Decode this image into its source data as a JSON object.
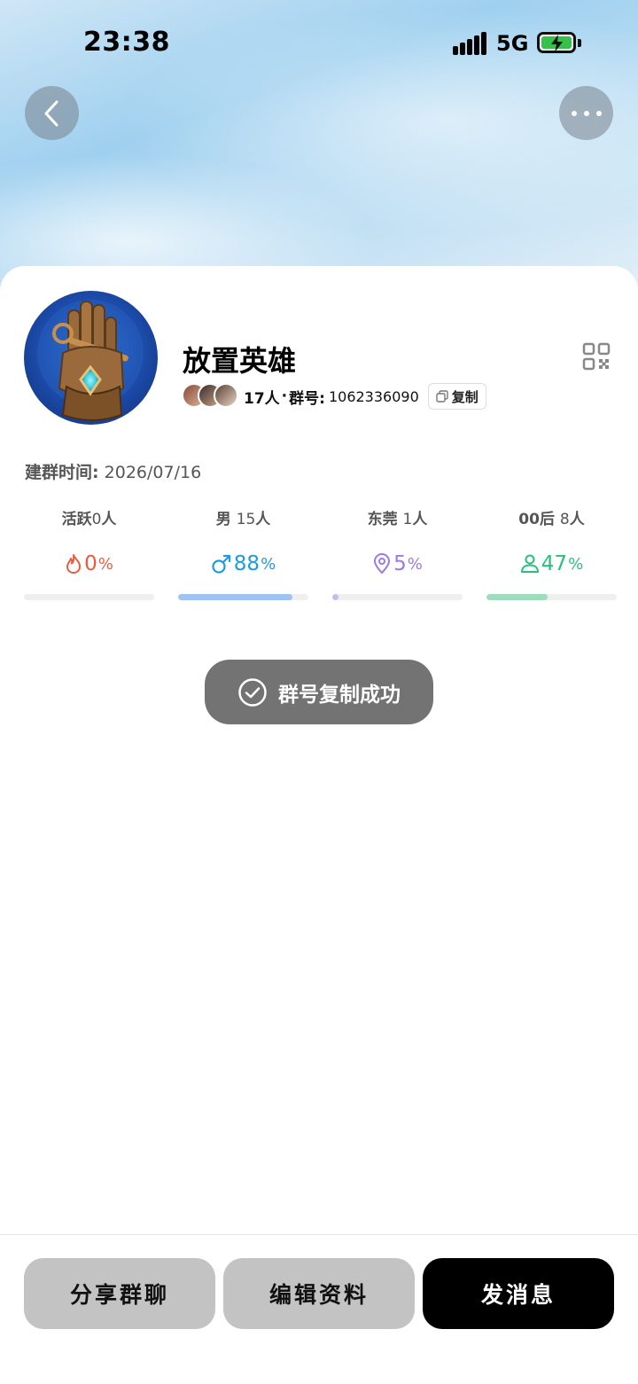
{
  "status_bar": {
    "time": "23:38",
    "network": "5G"
  },
  "group": {
    "name": "放置英雄",
    "member_count": "17人",
    "id_label": "群号:",
    "id": "1062336090",
    "copy_label": "复制",
    "created_label": "建群时间:",
    "created_date": "2026/07/16"
  },
  "stats": [
    {
      "label": "活跃",
      "num": "0",
      "unit": "人",
      "value": "0",
      "percent": 0,
      "color": "#ef5a3c",
      "icon": "flame-icon"
    },
    {
      "label": "男",
      "num": "15",
      "unit": "人",
      "value": "88",
      "percent": 88,
      "color": "#1d9be0",
      "icon": "male-icon",
      "bar_color": "#9fc2f3"
    },
    {
      "label": "东莞",
      "num": "1",
      "unit": "人",
      "value": "5",
      "percent": 5,
      "color": "#9b7be8",
      "icon": "location-pin-icon",
      "bar_color": "#c9b8f5"
    },
    {
      "label": "00后",
      "num": "8",
      "unit": "人",
      "value": "47",
      "percent": 47,
      "color": "#27c27a",
      "icon": "person-icon",
      "bar_color": "#9fdcbd"
    }
  ],
  "toast": {
    "text": "群号复制成功"
  },
  "actions": {
    "share": "分享群聊",
    "edit": "编辑资料",
    "send": "发消息"
  },
  "pct_sign": "%",
  "dot_sep": "·"
}
